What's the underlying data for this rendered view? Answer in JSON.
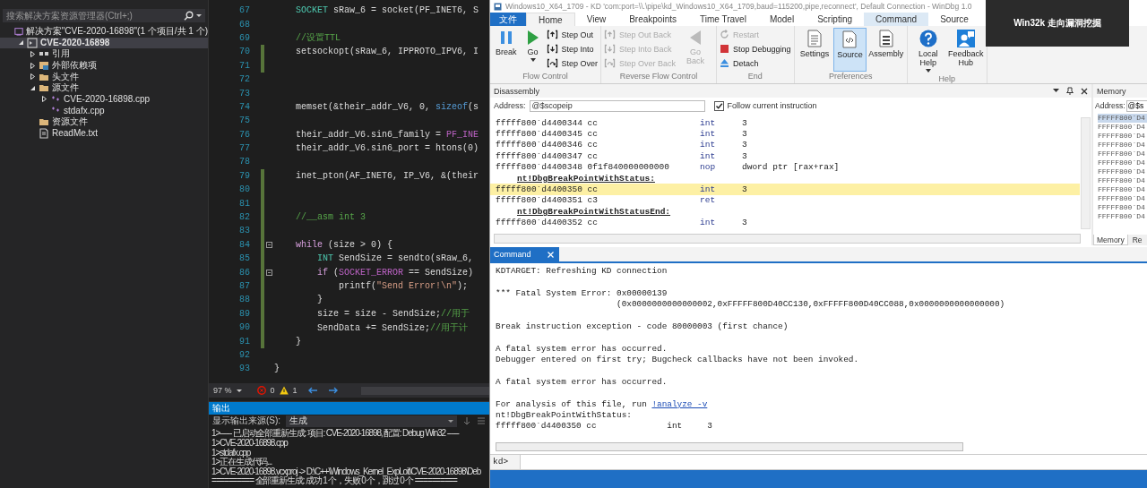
{
  "solution_explorer": {
    "search": {
      "placeholder": "搜索解决方案资源管理器(Ctrl+;)"
    },
    "tree": [
      {
        "label": "解决方案\"CVE-2020-16898\"(1 个项目/共 1 个)",
        "kind": "solution",
        "selected": false,
        "children": [
          {
            "label": "CVE-2020-16898",
            "kind": "project",
            "selected": true,
            "expanded": true,
            "children": [
              {
                "label": "引用",
                "kind": "references",
                "selected": false,
                "expanded": false
              },
              {
                "label": "外部依赖项",
                "kind": "external",
                "selected": false,
                "expanded": false
              },
              {
                "label": "头文件",
                "kind": "folder",
                "selected": false,
                "expanded": false
              },
              {
                "label": "源文件",
                "kind": "folder",
                "selected": false,
                "expanded": true,
                "children": [
                  {
                    "label": "CVE-2020-16898.cpp",
                    "kind": "cpp",
                    "selected": false,
                    "expanded": false
                  },
                  {
                    "label": "stdafx.cpp",
                    "kind": "cpp",
                    "selected": false
                  }
                ]
              },
              {
                "label": "资源文件",
                "kind": "folder",
                "selected": false
              },
              {
                "label": "ReadMe.txt",
                "kind": "text",
                "selected": false
              }
            ]
          }
        ]
      }
    ]
  },
  "editor": {
    "lines": [
      {
        "number": "67",
        "modified": false,
        "fold": false,
        "tokens": [
          {
            "text": "    SOCKET",
            "kind": "type"
          },
          {
            "text": " sRaw_6 = socket(PF_INET6, S",
            "kind": "plain"
          }
        ]
      },
      {
        "number": "68",
        "modified": false,
        "fold": false
      },
      {
        "number": "69",
        "modified": false,
        "fold": false,
        "tokens": [
          {
            "text": "    //设置TTL",
            "kind": "comment"
          }
        ]
      },
      {
        "number": "70",
        "modified": true,
        "fold": false,
        "tokens": [
          {
            "text": "    setsockopt(sRaw_6, IPPROTO_IPV6, I",
            "kind": "plain"
          }
        ]
      },
      {
        "number": "71",
        "modified": true,
        "fold": false
      },
      {
        "number": "72",
        "modified": false,
        "fold": false
      },
      {
        "number": "73",
        "modified": false,
        "fold": false
      },
      {
        "number": "74",
        "modified": false,
        "fold": false,
        "tokens": [
          {
            "text": "    memset(&their_addr_V6, 0, ",
            "kind": "plain"
          },
          {
            "text": "sizeof",
            "kind": "keyword"
          },
          {
            "text": "(s",
            "kind": "plain"
          }
        ]
      },
      {
        "number": "75",
        "modified": false,
        "fold": false
      },
      {
        "number": "76",
        "modified": false,
        "fold": false,
        "tokens": [
          {
            "text": "    their_addr_V6.sin6_family = ",
            "kind": "plain"
          },
          {
            "text": "PF_INE",
            "kind": "macro"
          }
        ]
      },
      {
        "number": "77",
        "modified": false,
        "fold": false,
        "tokens": [
          {
            "text": "    their_addr_V6.sin6_port = htons(0)",
            "kind": "plain"
          }
        ]
      },
      {
        "number": "78",
        "modified": false,
        "fold": false
      },
      {
        "number": "79",
        "modified": true,
        "fold": false,
        "tokens": [
          {
            "text": "    inet_pton(AF_INET6, IP_V6, &(their",
            "kind": "plain"
          }
        ]
      },
      {
        "number": "80",
        "modified": true,
        "fold": false
      },
      {
        "number": "81",
        "modified": true,
        "fold": false
      },
      {
        "number": "82",
        "modified": true,
        "fold": false,
        "tokens": [
          {
            "text": "    //__asm int 3",
            "kind": "comment"
          }
        ]
      },
      {
        "number": "83",
        "modified": true,
        "fold": false
      },
      {
        "number": "84",
        "modified": true,
        "fold": true,
        "tokens": [
          {
            "text": "    while",
            "kind": "control"
          },
          {
            "text": " (size > 0) {",
            "kind": "plain"
          }
        ]
      },
      {
        "number": "85",
        "modified": true,
        "fold": false,
        "tokens": [
          {
            "text": "        INT",
            "kind": "type"
          },
          {
            "text": " SendSize = sendto(sRaw_6,",
            "kind": "plain"
          }
        ]
      },
      {
        "number": "86",
        "modified": true,
        "fold": true,
        "tokens": [
          {
            "text": "        if",
            "kind": "control"
          },
          {
            "text": " (",
            "kind": "plain"
          },
          {
            "text": "SOCKET_ERROR",
            "kind": "macro"
          },
          {
            "text": " == SendSize)",
            "kind": "plain"
          }
        ]
      },
      {
        "number": "87",
        "modified": true,
        "fold": false,
        "tokens": [
          {
            "text": "            printf(",
            "kind": "plain"
          },
          {
            "text": "\"Send Error!\\n\"",
            "kind": "string"
          },
          {
            "text": ");",
            "kind": "plain"
          }
        ]
      },
      {
        "number": "88",
        "modified": true,
        "fold": false,
        "tokens": [
          {
            "text": "        }",
            "kind": "plain"
          }
        ]
      },
      {
        "number": "89",
        "modified": true,
        "fold": false,
        "tokens": [
          {
            "text": "        size = size - SendSize;",
            "kind": "plain"
          },
          {
            "text": "//用于",
            "kind": "comment"
          }
        ]
      },
      {
        "number": "90",
        "modified": true,
        "fold": false,
        "tokens": [
          {
            "text": "        SendData += SendSize;",
            "kind": "plain"
          },
          {
            "text": "//用于计",
            "kind": "comment"
          }
        ]
      },
      {
        "number": "91",
        "modified": true,
        "fold": false,
        "tokens": [
          {
            "text": "    }",
            "kind": "plain"
          }
        ]
      },
      {
        "number": "92",
        "modified": false,
        "fold": false
      },
      {
        "number": "93",
        "modified": false,
        "fold": false,
        "tokens": [
          {
            "text": "}",
            "kind": "plain"
          }
        ]
      }
    ]
  },
  "editor_status": {
    "zoom": "97 %",
    "errors": "0",
    "warnings": "1"
  },
  "output": {
    "title": "输出",
    "source_label": "显示输出来源(S):",
    "source_value": "生成",
    "lines": [
      "1>------ 已启动全部重新生成: 项目: CVE-2020-16898, 配置: Debug Win32 ------",
      "1>CVE-2020-16898.cpp",
      "1>stdafx.cpp",
      "1>正在生成代码...",
      "1>CVE-2020-16898.vcxproj -> D:\\C++\\Windows_Kernel_ExpLoit\\CVE-2020-16898\\Deb",
      "========== 全部重新生成: 成功 1 个，失败 0 个，跳过 0 个 =========="
    ]
  },
  "windbg": {
    "title": "Windows10_X64_1709 - KD 'com:port=\\\\.\\pipe\\kd_Windows10_X64_1709,baud=115200,pipe,reconnect', Default Connection  - WinDbg 1.0",
    "tabs": [
      {
        "label": "文件",
        "kind": "file",
        "selected": false
      },
      {
        "label": "Home",
        "kind": "normal",
        "selected": true
      },
      {
        "label": "View",
        "kind": "normal",
        "selected": false
      },
      {
        "label": "Breakpoints",
        "kind": "normal",
        "selected": false
      },
      {
        "label": "Time Travel",
        "kind": "normal",
        "selected": false
      },
      {
        "label": "Model",
        "kind": "normal",
        "selected": false
      },
      {
        "label": "Scripting",
        "kind": "normal",
        "selected": false
      },
      {
        "label": "Command",
        "kind": "contextual",
        "selected": false
      },
      {
        "label": "Source",
        "kind": "normal",
        "selected": false
      }
    ],
    "groups": [
      {
        "label": "Flow Control",
        "items": [
          {
            "label": "Break",
            "kind": "large",
            "disabled": false,
            "selected": false,
            "menu": false
          },
          {
            "label": "Go",
            "kind": "large",
            "disabled": false,
            "selected": false,
            "menu": true
          },
          {
            "label": "Step Out",
            "kind": "small",
            "disabled": false,
            "selected": false,
            "menu": false
          },
          {
            "label": "Step Into",
            "kind": "small",
            "disabled": false,
            "selected": false,
            "menu": false
          },
          {
            "label": "Step Over",
            "kind": "small",
            "disabled": false,
            "selected": false,
            "menu": false
          }
        ]
      },
      {
        "label": "Reverse Flow Control",
        "items": [
          {
            "label": "Step Out Back",
            "kind": "small",
            "disabled": true,
            "selected": false,
            "menu": false
          },
          {
            "label": "Step Into Back",
            "kind": "small",
            "disabled": true,
            "selected": false,
            "menu": false
          },
          {
            "label": "Step Over Back",
            "kind": "small",
            "disabled": true,
            "selected": false,
            "menu": false
          },
          {
            "label": "Go Back",
            "kind": "large",
            "disabled": true,
            "selected": false,
            "menu": false
          }
        ]
      },
      {
        "label": "End",
        "items": [
          {
            "label": "Restart",
            "kind": "small",
            "disabled": true,
            "selected": false,
            "menu": false
          },
          {
            "label": "Stop Debugging",
            "kind": "small",
            "disabled": false,
            "selected": false,
            "menu": false
          },
          {
            "label": "Detach",
            "kind": "small",
            "disabled": false,
            "selected": false,
            "menu": false
          }
        ]
      },
      {
        "label": "Preferences",
        "items": [
          {
            "label": "Settings",
            "kind": "large",
            "disabled": false,
            "selected": false,
            "menu": false
          },
          {
            "label": "Source",
            "kind": "large",
            "disabled": false,
            "selected": true,
            "menu": false
          },
          {
            "label": "Assembly",
            "kind": "large",
            "disabled": false,
            "selected": false,
            "menu": false
          }
        ]
      },
      {
        "label": "Help",
        "items": [
          {
            "label": "Local Help",
            "kind": "large",
            "disabled": false,
            "selected": false,
            "menu": true
          },
          {
            "label": "Feedback Hub",
            "kind": "large",
            "disabled": false,
            "selected": false,
            "menu": false
          }
        ]
      }
    ],
    "disassembly": {
      "title": "Disassembly",
      "address_label": "Address:",
      "address": "@$scopeip",
      "follow": {
        "label": "Follow current instruction",
        "checked": true
      },
      "rows": [
        {
          "kind": "instr",
          "current": false,
          "code": "fffff800`d4400344 cc",
          "op": "int",
          "args": "3"
        },
        {
          "kind": "instr",
          "current": false,
          "code": "fffff800`d4400345 cc",
          "op": "int",
          "args": "3"
        },
        {
          "kind": "instr",
          "current": false,
          "code": "fffff800`d4400346 cc",
          "op": "int",
          "args": "3"
        },
        {
          "kind": "instr",
          "current": false,
          "code": "fffff800`d4400347 cc",
          "op": "int",
          "args": "3"
        },
        {
          "kind": "instr",
          "current": false,
          "code": "fffff800`d4400348 0f1f840000000000",
          "op": "nop",
          "args": "dword ptr [rax+rax]"
        },
        {
          "kind": "label",
          "current": false,
          "code": "nt!DbgBreakPointWithStatus:"
        },
        {
          "kind": "instr",
          "current": true,
          "code": "fffff800`d4400350 cc",
          "op": "int",
          "args": "3"
        },
        {
          "kind": "instr",
          "current": false,
          "code": "fffff800`d4400351 c3",
          "op": "ret"
        },
        {
          "kind": "label",
          "current": false,
          "code": "nt!DbgBreakPointWithStatusEnd:"
        },
        {
          "kind": "instr",
          "current": false,
          "code": "fffff800`d4400352 cc",
          "op": "int",
          "args": "3"
        }
      ]
    },
    "memory": {
      "title": "Memory",
      "address_label": "Address:",
      "address": "@$s",
      "rows": [
        {
          "text": "FFFFF800`D4",
          "selected": true
        },
        {
          "text": "FFFFF800`D4",
          "selected": false
        },
        {
          "text": "FFFFF800`D4",
          "selected": false
        },
        {
          "text": "FFFFF800`D4",
          "selected": false
        },
        {
          "text": "FFFFF800`D4",
          "selected": false
        },
        {
          "text": "FFFFF800`D4",
          "selected": false
        },
        {
          "text": "FFFFF800`D4",
          "selected": false
        },
        {
          "text": "FFFFF800`D4",
          "selected": false
        },
        {
          "text": "FFFFF800`D4",
          "selected": false
        },
        {
          "text": "FFFFF800`D4",
          "selected": false
        },
        {
          "text": "FFFFF800`D4",
          "selected": false
        },
        {
          "text": "FFFFF800`D4",
          "selected": false
        }
      ],
      "tabs": [
        {
          "label": "Memory",
          "selected": true
        },
        {
          "label": "Re",
          "selected": false
        }
      ]
    },
    "command": {
      "tab": "Command",
      "prompt": "kd>",
      "blocks": [
        [
          {
            "text": "KDTARGET: Refreshing KD connection"
          }
        ],
        [
          {
            "text": "*** Fatal System Error: 0x00000139"
          },
          {
            "text": "                        (0x0000000000000002,0xFFFFF800D40CC130,0xFFFFF800D40CC088,0x0000000000000000)"
          }
        ],
        [
          {
            "text": "Break instruction exception - code 80000003 (first chance)"
          }
        ],
        [
          {
            "text": "A fatal system error has occurred."
          },
          {
            "text": "Debugger entered on first try; Bugcheck callbacks have not been invoked."
          }
        ],
        [
          {
            "text": "A fatal system error has occurred."
          }
        ],
        [
          {
            "text": "For analysis of this file, run ",
            "link": "!analyze -v"
          },
          {
            "text": "nt!DbgBreakPointWithStatus:"
          },
          {
            "text": "fffff800`d4400350 cc              int     3"
          }
        ]
      ]
    }
  },
  "overlay": {
    "title": "Win32k 走向漏洞挖掘"
  }
}
